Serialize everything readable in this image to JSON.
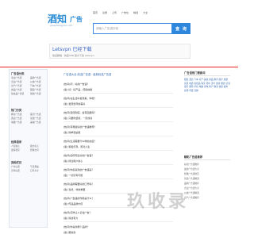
{
  "logo": {
    "text1": "酒知",
    "text2": "广告",
    "tagline": "www.fangyoui.com"
  },
  "topnav": [
    "首页",
    "注册",
    "上传",
    "广告位",
    "精选",
    "大全"
  ],
  "search": {
    "placeholder": "请输入广告语字段",
    "button": "查 询"
  },
  "ad": {
    "headline": "Letsvpn 已经下载",
    "sub": "快连翻墙 · 快连VPN 官方下载 Letsvpn"
  },
  "left": {
    "sections": [
      {
        "title": "广告语分类",
        "items": [
          "专业广告语",
          "品牌广告语",
          "企业广告语",
          "公益广告语",
          "房产广告语",
          "汽车广告语",
          "食品广告语",
          "服装广告语",
          "化妆品广告语",
          "旅游广告语"
        ]
      },
      {
        "title": "热门分类",
        "items": [
          "教育广告语",
          "医疗广告语",
          "酒店广告语",
          "家居广告语",
          "电器广告语",
          "美容广告语"
        ]
      },
      {
        "title": "经典语录",
        "items": [
          "人生格言",
          "励志名言",
          "爱情语录",
          "经典台词"
        ]
      },
      {
        "title": "其他栏目",
        "items": [
          "广告标语",
          "节日祝福",
          "宣传标语",
          "口号大全"
        ]
      }
    ]
  },
  "center": {
    "title": "广告语大全-精选广告语 · 最新精选广告语",
    "items": [
      {
        "q": "[热评]问：好的广告语？",
        "a": "[答] 好！好产品，值得信赖"
      },
      {
        "q": "[热评]在生活中发现美，你呢？",
        "a": "[答] 发现世界的美好"
      },
      {
        "q": "[热评]坚持到底，会有回报吗？",
        "a": "[答] 只要你坚持，一定成功"
      },
      {
        "q": "[热评]有哪些好的广告语推荐？",
        "a": "[答] 简单就是美"
      },
      {
        "q": "[热评]生活需要什么样的态度？",
        "a": "[答] 积极乐观，笑对人生"
      },
      {
        "q": "[热评]如何写出好的广告语？",
        "a": "[答] 抓住用户的心"
      },
      {
        "q": "[热评]你最喜欢的广告语是？",
        "a": "[答] 一切皆有可能"
      },
      {
        "q": "[热评]品牌需要好的口号吗？",
        "a": "[答] 当然，非常重要"
      },
      {
        "q": "[热评]广告语的作用是什么？",
        "a": "[答] 传递品牌价值"
      },
      {
        "q": "[热评]怎样让人记住广告？",
        "a": "[答] 简洁有力"
      },
      {
        "q": "[热评]你喜欢哪个品牌？",
        "a": "[答] 都喜欢"
      }
    ]
  },
  "right": {
    "box1_title": "广告语热门搜索词",
    "words": "服装 酒店 汽车 房产 美容 食品 教育 医疗 旅游 家居 电器 化妆品 珠宝 酒水 茶叶 健身 餐饮 培训 银行 保险 手机 电脑 家电 地产 物流 快递 超市 商场 母婴 宠物",
    "box2_title": "精彩广告语推荐",
    "list": [
      "好的广告语推荐",
      "最新广告语大全",
      "经典广告语欣赏",
      "创意广告语精选",
      "品牌广告语推荐",
      "企业广告语大全",
      "公益广告语精选",
      "房产广告语推荐"
    ]
  },
  "watermark": "玖收录"
}
